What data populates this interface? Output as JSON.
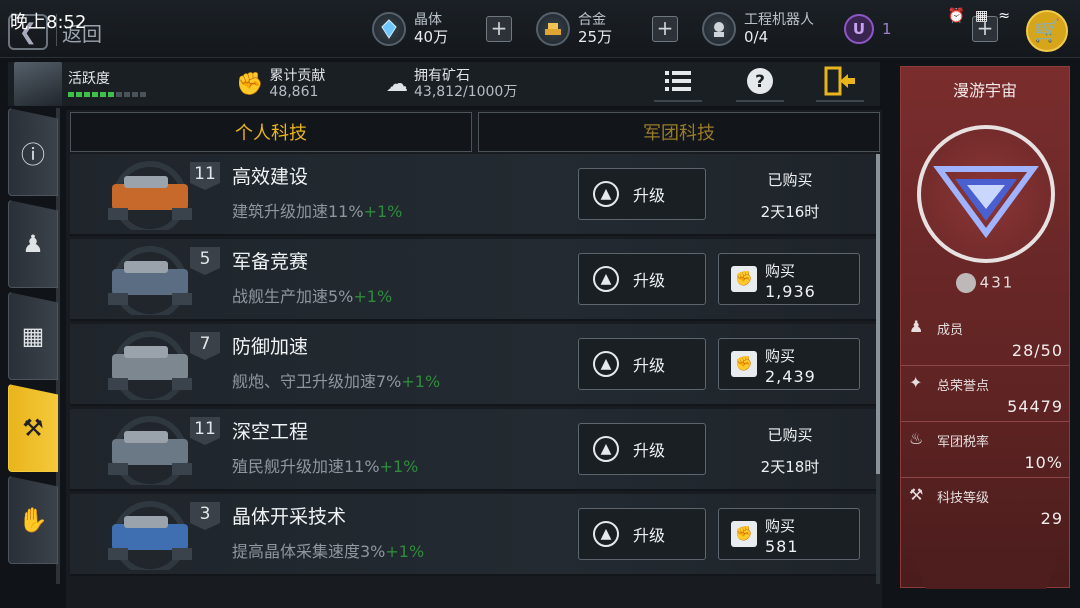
{
  "status": {
    "time": "晚上8:52"
  },
  "header": {
    "back_label": "返回",
    "resources": [
      {
        "name": "晶体",
        "value": "40万",
        "icon": "crystal-icon"
      },
      {
        "name": "合金",
        "value": "25万",
        "icon": "alloy-icon"
      },
      {
        "name": "工程机器人",
        "value": "0/4",
        "icon": "robot-icon"
      },
      {
        "name": "",
        "value": "1",
        "icon": "u-currency-icon"
      }
    ]
  },
  "stats": {
    "activity_label": "活跃度",
    "activity_level": 0.55,
    "contribution_label": "累计贡献",
    "contribution_value": "48,861",
    "ore_label": "拥有矿石",
    "ore_value": "43,812/1000万"
  },
  "tabs": [
    {
      "label": "个人科技",
      "active": true
    },
    {
      "label": "军团科技",
      "active": false
    }
  ],
  "tech": [
    {
      "level": "11",
      "title": "高效建设",
      "desc": "建筑升级加速11%",
      "bonus": "+1%",
      "upgrade": "升级",
      "state": "bought",
      "status": "已购买",
      "time": "2天16时",
      "buy": "",
      "price": ""
    },
    {
      "level": "5",
      "title": "军备竞赛",
      "desc": "战舰生产加速5%",
      "bonus": "+1%",
      "upgrade": "升级",
      "state": "buy",
      "status": "",
      "time": "",
      "buy": "购买",
      "price": "1,936"
    },
    {
      "level": "7",
      "title": "防御加速",
      "desc": "舰炮、守卫升级加速7%",
      "bonus": "+1%",
      "upgrade": "升级",
      "state": "buy",
      "status": "",
      "time": "",
      "buy": "购买",
      "price": "2,439"
    },
    {
      "level": "11",
      "title": "深空工程",
      "desc": "殖民舰升级加速11%",
      "bonus": "+1%",
      "upgrade": "升级",
      "state": "bought",
      "status": "已购买",
      "time": "2天18时",
      "buy": "",
      "price": ""
    },
    {
      "level": "3",
      "title": "晶体开采技术",
      "desc": "提高晶体采集速度3%",
      "bonus": "+1%",
      "upgrade": "升级",
      "state": "buy",
      "status": "",
      "time": "",
      "buy": "购买",
      "price": "581"
    }
  ],
  "guild": {
    "name": "漫游宇宙",
    "points": "431",
    "stats": [
      {
        "label": "成员",
        "value": "28/50",
        "icon": "member-icon"
      },
      {
        "label": "总荣誉点",
        "value": "54479",
        "icon": "wings-icon"
      },
      {
        "label": "军团税率",
        "value": "10%",
        "icon": "tax-icon"
      },
      {
        "label": "科技等级",
        "value": "29",
        "icon": "microscope-icon"
      }
    ]
  },
  "colors": {
    "accent": "#e9b41c",
    "bonus": "#2e8c3c",
    "guild_panel": "#6a2727"
  }
}
